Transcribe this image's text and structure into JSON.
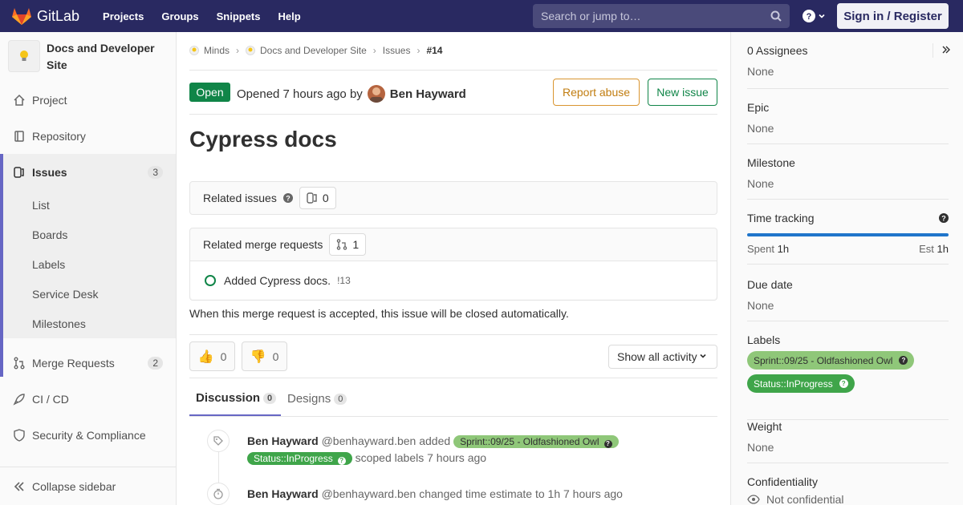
{
  "navbar": {
    "brand": "GitLab",
    "links": [
      "Projects",
      "Groups",
      "Snippets",
      "Help"
    ],
    "search_placeholder": "Search or jump to…",
    "signin": "Sign in / Register"
  },
  "sidebar": {
    "project_name": "Docs and Developer Site",
    "items": [
      {
        "label": "Project",
        "icon": "home-icon"
      },
      {
        "label": "Repository",
        "icon": "book-icon"
      },
      {
        "label": "Issues",
        "icon": "issues-icon",
        "count": "3"
      },
      {
        "label": "Merge Requests",
        "icon": "merge-request-icon",
        "count": "2"
      },
      {
        "label": "CI / CD",
        "icon": "rocket-icon"
      },
      {
        "label": "Security & Compliance",
        "icon": "shield-icon"
      }
    ],
    "issues_sub": [
      "List",
      "Boards",
      "Labels",
      "Service Desk",
      "Milestones"
    ],
    "collapse": "Collapse sidebar"
  },
  "breadcrumb": [
    "Minds",
    "Docs and Developer Site",
    "Issues",
    "#14"
  ],
  "issue": {
    "status": "Open",
    "opened_text": "Opened 7 hours ago by",
    "author": "Ben Hayward",
    "report_abuse": "Report abuse",
    "new_issue": "New issue",
    "title": "Cypress docs",
    "related_issues_label": "Related issues",
    "related_issues_count": "0",
    "related_mr_label": "Related merge requests",
    "related_mr_count": "1",
    "mr_title": "Added Cypress docs.",
    "mr_ref": "!13",
    "auto_close": "When this merge request is accepted, this issue will be closed automatically.",
    "thumbs_up": "0",
    "thumbs_down": "0",
    "activity_filter": "Show all activity",
    "tabs": [
      {
        "label": "Discussion",
        "count": "0"
      },
      {
        "label": "Designs",
        "count": "0"
      }
    ],
    "notes": [
      {
        "author": "Ben Hayward",
        "handle": "@benhayward.ben",
        "verb": "added",
        "label1": "Sprint::09/25 - Oldfashioned Owl",
        "label2": "Status::InProgress",
        "tail": "scoped labels 7 hours ago"
      },
      {
        "author": "Ben Hayward",
        "handle": "@benhayward.ben",
        "text": "changed time estimate to 1h 7 hours ago"
      }
    ]
  },
  "right_sidebar": {
    "assignees_title": "0 Assignees",
    "assignees_value": "None",
    "epic_title": "Epic",
    "epic_value": "None",
    "milestone_title": "Milestone",
    "milestone_value": "None",
    "time_title": "Time tracking",
    "spent_label": "Spent",
    "spent_value": "1h",
    "est_label": "Est",
    "est_value": "1h",
    "due_title": "Due date",
    "due_value": "None",
    "labels_title": "Labels",
    "labels": [
      {
        "text": "Sprint::09/25 - Oldfashioned Owl",
        "color": "#8fc779"
      },
      {
        "text": "Status::InProgress",
        "color": "#3fa54a"
      }
    ],
    "weight_title": "Weight",
    "weight_value": "None",
    "confidentiality_title": "Confidentiality",
    "confidentiality_value": "Not confidential"
  },
  "colors": {
    "navbar": "#292961",
    "accent": "#6666c4",
    "open_green": "#108548",
    "abuse_orange": "#d99530",
    "time_blue": "#1f75cb"
  }
}
